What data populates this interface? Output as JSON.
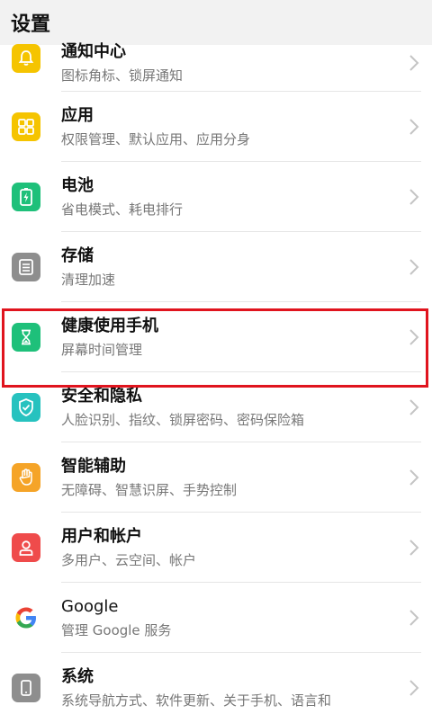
{
  "header": {
    "title": "设置"
  },
  "items": [
    {
      "title": "通知中心",
      "subtitle": "图标角标、锁屏通知",
      "icon": "bell-icon",
      "color": "#f5c400"
    },
    {
      "title": "应用",
      "subtitle": "权限管理、默认应用、应用分身",
      "icon": "apps-grid-icon",
      "color": "#f5c400"
    },
    {
      "title": "电池",
      "subtitle": "省电模式、耗电排行",
      "icon": "battery-icon",
      "color": "#1ec07a"
    },
    {
      "title": "存储",
      "subtitle": "清理加速",
      "icon": "storage-icon",
      "color": "#8e8e8e"
    },
    {
      "title": "健康使用手机",
      "subtitle": "屏幕时间管理",
      "icon": "hourglass-icon",
      "color": "#1ec07a"
    },
    {
      "title": "安全和隐私",
      "subtitle": "人脸识别、指纹、锁屏密码、密码保险箱",
      "icon": "shield-icon",
      "color": "#27c2bf"
    },
    {
      "title": "智能辅助",
      "subtitle": "无障碍、智慧识屏、手势控制",
      "icon": "hand-icon",
      "color": "#f5a428"
    },
    {
      "title": "用户和帐户",
      "subtitle": "多用户、云空间、帐户",
      "icon": "user-icon",
      "color": "#ef4b4b"
    },
    {
      "title": "Google",
      "subtitle": "管理 Google 服务",
      "icon": "google-icon",
      "color": "#ffffff"
    },
    {
      "title": "系统",
      "subtitle": "系统导航方式、软件更新、关于手机、语言和",
      "icon": "phone-icon",
      "color": "#8e8e8e"
    }
  ],
  "highlight_color": "#e0141e"
}
